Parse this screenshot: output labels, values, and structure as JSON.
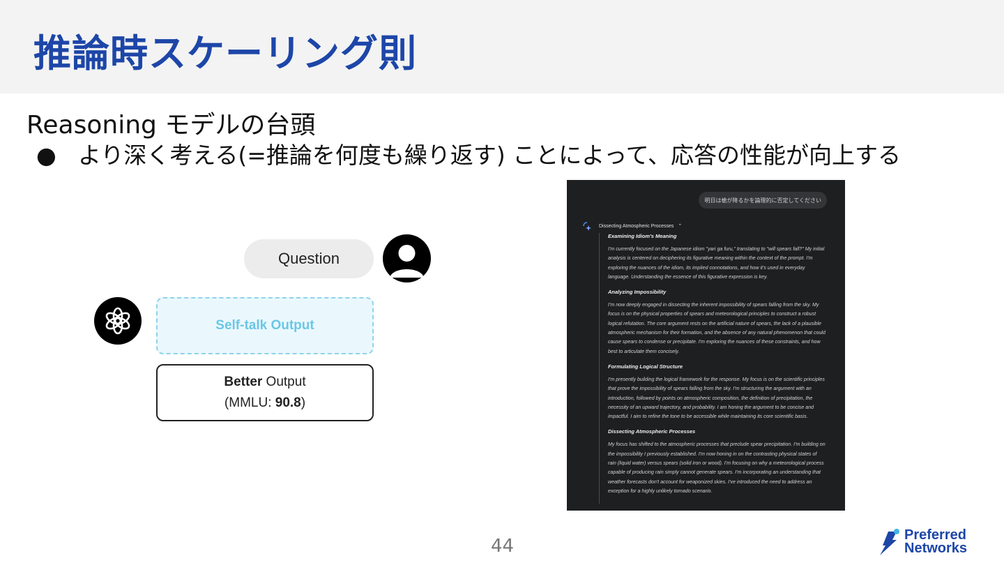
{
  "slide": {
    "title": "推論時スケーリング則",
    "subtitle": "Reasoning モデルの台頭",
    "bullet_symbol": "●",
    "bullet": "より深く考える(=推論を何度も繰り返す) ことによって、応答の性能が向上する",
    "page_number": "44"
  },
  "diagram": {
    "question_label": "Question",
    "selftalk_label": "Self-talk Output",
    "better_bold": "Better",
    "better_rest": " Output",
    "mmlu_prefix": "(MMLU: ",
    "mmlu_value": "90.8",
    "mmlu_suffix": ")",
    "icons": [
      "user-avatar-icon",
      "openai-logo-icon"
    ]
  },
  "screenshot": {
    "user_query": "明日は槍が降るかを論理的に否定してください",
    "thought_title": "Dissecting Atmospheric Processes",
    "sections": [
      {
        "heading": "Examining Idiom's Meaning",
        "text": "I'm currently focused on the Japanese idiom \"yari ga furu,\" translating to \"will spears fall?\" My initial analysis is centered on deciphering its figurative meaning within the context of the prompt. I'm exploring the nuances of the idiom, its implied connotations, and how it's used in everyday language. Understanding the essence of this figurative expression is key."
      },
      {
        "heading": "Analyzing Impossibility",
        "text": "I'm now deeply engaged in dissecting the inherent impossibility of spears falling from the sky. My focus is on the physical properties of spears and meteorological principles to construct a robust logical refutation. The core argument rests on the artificial nature of spears, the lack of a plausible atmospheric mechanism for their formation, and the absence of any natural phenomenon that could cause spears to condense or precipitate. I'm exploring the nuances of these constraints, and how best to articulate them concisely."
      },
      {
        "heading": "Formulating Logical Structure",
        "text": "I'm presently building the logical framework for the response. My focus is on the scientific principles that prove the impossibility of spears falling from the sky. I'm structuring the argument with an introduction, followed by points on atmospheric composition, the definition of precipitation, the necessity of an upward trajectory, and probability. I am honing the argument to be concise and impactful. I aim to refine the tone to be accessible while maintaining its core scientific basis."
      },
      {
        "heading": "Dissecting Atmospheric Processes",
        "text": "My focus has shifted to the atmospheric processes that preclude spear precipitation. I'm building on the impossibility I previously established. I'm now honing in on the contrasting physical states of rain (liquid water) versus spears (solid iron or wood). I'm focusing on why a meteorological process capable of producing rain simply cannot generate spears. I'm incorporating an understanding that weather forecasts don't account for weaponized skies. I've introduced the need to address an exception for a highly unlikely tornado scenario."
      }
    ]
  },
  "logo": {
    "line1": "Preferred",
    "line2": "Networks"
  },
  "colors": {
    "title": "#1d46a8",
    "header_band": "#f3f3f3",
    "selftalk_text": "#6cc6e6",
    "dark_panel": "#1e1f20"
  }
}
